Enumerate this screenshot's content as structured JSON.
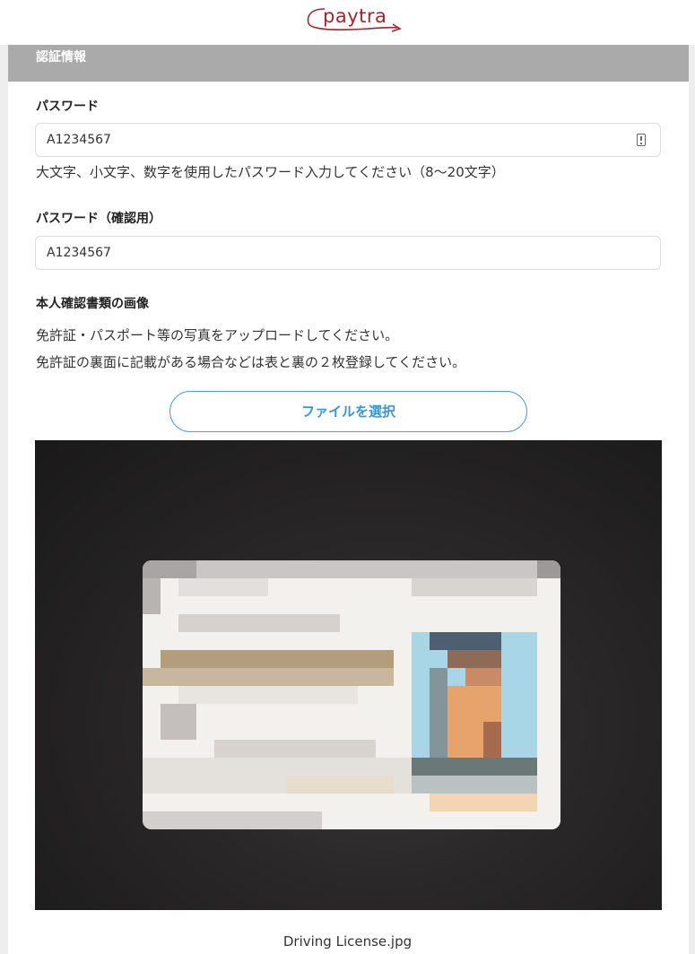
{
  "brand": {
    "logo_text": "paytra",
    "color": "#a3262e"
  },
  "section": {
    "title": "認証情報"
  },
  "password": {
    "label": "パスワード",
    "value": "A1234567",
    "reveal_icon": "password-reveal-icon",
    "help": "大文字、小文字、数字を使用したパスワード入力してください（8～20文字）"
  },
  "password_confirm": {
    "label": "パスワード（確認用）",
    "value": "A1234567"
  },
  "identity": {
    "label": "本人確認書類の画像",
    "help_line1": "免許証・パスポート等の写真をアップロードしてください。",
    "help_line2": "免許証の裏面に記載がある場合などは表と裏の２枚登録してください。",
    "file_button": "ファイルを選択",
    "file_name": "Driving License.jpg"
  },
  "colors": {
    "accent": "#3a95d4",
    "header_bg": "#aaaaaa"
  }
}
